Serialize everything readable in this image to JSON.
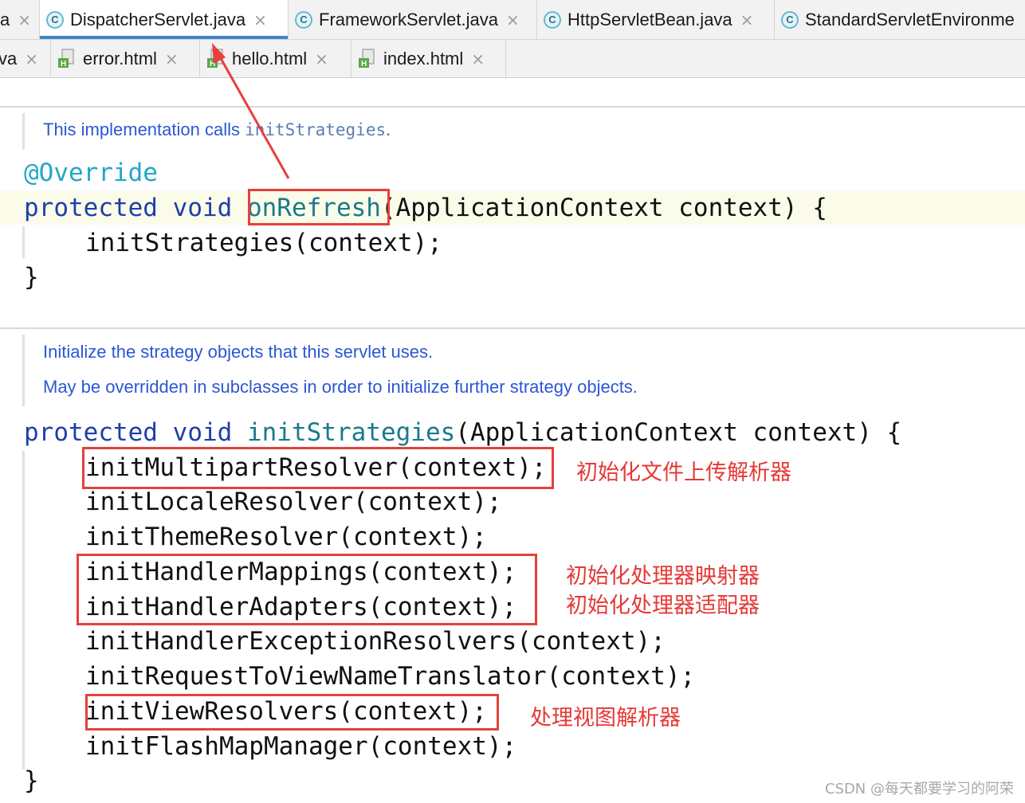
{
  "tabs_row1": [
    {
      "label": "a",
      "icon": "none",
      "active": false
    },
    {
      "label": "DispatcherServlet.java",
      "icon": "java-class-icon",
      "active": true
    },
    {
      "label": "FrameworkServlet.java",
      "icon": "java-class-icon",
      "active": false
    },
    {
      "label": "HttpServletBean.java",
      "icon": "java-class-icon",
      "active": false
    },
    {
      "label": "StandardServletEnvironme",
      "icon": "java-class-icon",
      "active": false
    }
  ],
  "tabs_row2": [
    {
      "label": "va",
      "icon": "none",
      "active": false
    },
    {
      "label": "error.html",
      "icon": "html-file-icon",
      "active": false
    },
    {
      "label": "hello.html",
      "icon": "html-file-icon",
      "active": false
    },
    {
      "label": "index.html",
      "icon": "html-file-icon",
      "active": false
    }
  ],
  "close_glyph": "×",
  "icon_letter": "C",
  "doc1": {
    "prefix": "This implementation calls ",
    "code": "initStrategies",
    "suffix": "."
  },
  "annotation": "@Override",
  "method1": {
    "kw_protected": "protected",
    "kw_void": "void",
    "name": "onRefresh",
    "params": "(ApplicationContext context) {",
    "body": "initStrategies(context);",
    "close": "}"
  },
  "doc2": {
    "line1": "Initialize the strategy objects that this servlet uses.",
    "line2": "May be overridden in subclasses in order to initialize further strategy objects."
  },
  "method2": {
    "kw_protected": "protected",
    "kw_void": "void",
    "name": "initStrategies",
    "params": "(ApplicationContext context) {",
    "body": [
      "initMultipartResolver(context);",
      "initLocaleResolver(context);",
      "initThemeResolver(context);",
      "initHandlerMappings(context);",
      "initHandlerAdapters(context);",
      "initHandlerExceptionResolvers(context);",
      "initRequestToViewNameTranslator(context);",
      "initViewResolvers(context);",
      "initFlashMapManager(context);"
    ],
    "close": "}"
  },
  "annotations_cn": {
    "multipart": "初始化文件上传解析器",
    "handler_mappings": "初始化处理器映射器",
    "handler_adapters": "初始化处理器适配器",
    "view_resolvers": "处理视图解析器"
  },
  "watermark": "CSDN @每天都要学习的阿荣",
  "colors": {
    "keyword": "#1f3ea8",
    "method_name": "#1b7a8c",
    "annotation": "#23a6c6",
    "doc_comment": "#2b57d4",
    "markup_red": "#e53935",
    "active_tab_underline": "#4083c9"
  }
}
